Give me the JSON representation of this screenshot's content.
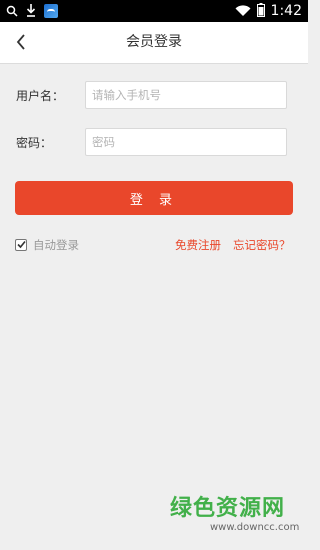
{
  "status_bar": {
    "time": "1:42",
    "icons": [
      "search-icon",
      "download-icon",
      "app-thumb-icon",
      "wifi-icon",
      "battery-icon"
    ]
  },
  "header": {
    "back_icon": "chevron-left-icon",
    "title": "会员登录"
  },
  "form": {
    "username_label": "用户名：",
    "username_placeholder": "请输入手机号",
    "username_value": "",
    "password_label": "密码：",
    "password_placeholder": "密码",
    "password_value": ""
  },
  "login_button": "登 录",
  "options": {
    "auto_login_label": "自动登录",
    "auto_login_checked": true,
    "register_link": "免费注册",
    "forgot_link": "忘记密码？"
  },
  "watermark": {
    "text": "绿色资源网",
    "url": "www.downcc.com"
  },
  "colors": {
    "accent": "#e9472b",
    "background": "#efefef",
    "header": "#ffffff",
    "watermark_green": "#42b04a"
  }
}
